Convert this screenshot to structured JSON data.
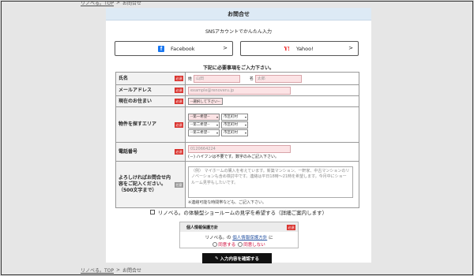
{
  "breadcrumb": {
    "home": "リノベる。TOP",
    "separator": ">",
    "current": "お問合せ"
  },
  "header": {
    "title": "お問合せ"
  },
  "sns": {
    "title": "SNSアカウントでかんたん入力",
    "facebook_label": "Facebook",
    "facebook_icon": "f",
    "yahoo_label": "Yahoo!",
    "yahoo_icon": "Y!",
    "arrow": ">"
  },
  "instruction": "下記に必要事項をご入力下さい。",
  "required_badge": "必須",
  "optional_badge": "任意",
  "form": {
    "name": {
      "label": "氏名",
      "last_prefix": "姓",
      "last_placeholder": "山田",
      "first_prefix": "名",
      "first_placeholder": "太郎"
    },
    "email": {
      "label": "メールアドレス",
      "placeholder": "example@renoveru.jp"
    },
    "residence": {
      "label": "現在のお住まい",
      "select_value": "--選択して下さい--"
    },
    "area": {
      "label": "物件を探すエリア",
      "rows": [
        {
          "pref": "--第一希望--",
          "city": "市区町村"
        },
        {
          "pref": "--第二希望--",
          "city": "市区町村"
        },
        {
          "pref": "--第三希望--",
          "city": "市区町村"
        }
      ]
    },
    "phone": {
      "label": "電話番号",
      "placeholder": "0120664224",
      "note": "(－) ハイフンは不要です。数字のみご記入下さい。"
    },
    "inquiry": {
      "label": "よろしければお問合せ内容をご記入ください。（500文字まで）",
      "placeholder": "（例） マイホームの購入を考えています。新築マンション、一軒家、中古マンションのリノベーションも含め検討中です。連絡は平日18時～21時を希望します。今月中にショールーム見学もしたいです。",
      "note": "※連絡可能な時間帯なども、ご記入下さい。"
    }
  },
  "showroom_check": "リノベる。の体験型ショールームの見学を希望する（詳細ご案内します）",
  "privacy": {
    "title": "個人情報保護方針",
    "text_prefix": "リノベる。の",
    "link": "個人情報保護方針",
    "text_suffix": "に",
    "agree": "同意する",
    "disagree": "同意しない"
  },
  "submit": {
    "label": "入力内容を確認する",
    "icon": "pencil-icon"
  },
  "colors": {
    "header_bg": "#ddeaf5",
    "required": "#d9322d",
    "field_pink": "#fce3e5",
    "facebook": "#1877f2",
    "yahoo": "#ee0000",
    "submit_bg": "#111111"
  }
}
